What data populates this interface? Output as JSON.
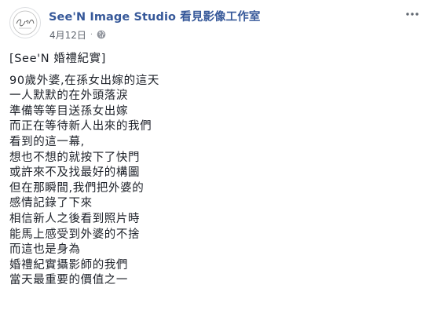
{
  "post": {
    "author": "See'N Image Studio 看見影像工作室",
    "date": "4月12日",
    "separator": "·",
    "privacy_icon": "globe-icon",
    "menu_icon": "more-options-icon",
    "avatar_logo_text": "See'N",
    "title": "[See'N 婚禮紀實]",
    "lines": [
      "90歲外婆,在孫女出嫁的這天",
      "一人默默的在外頭落淚",
      "準備等等目送孫女出嫁",
      "而正在等待新人出來的我們",
      "看到的這一幕,",
      "想也不想的就按下了快門",
      "或許來不及找最好的構圖",
      "但在那瞬間,我們把外婆的",
      "感情記錄了下來",
      "相信新人之後看到照片時",
      "能馬上感受到外婆的不捨",
      "而這也是身為",
      "婚禮紀實攝影師的我們",
      "當天最重要的價值之一"
    ]
  },
  "colors": {
    "author_link": "#365899",
    "meta_text": "#616770",
    "body_text": "#1d2129"
  }
}
